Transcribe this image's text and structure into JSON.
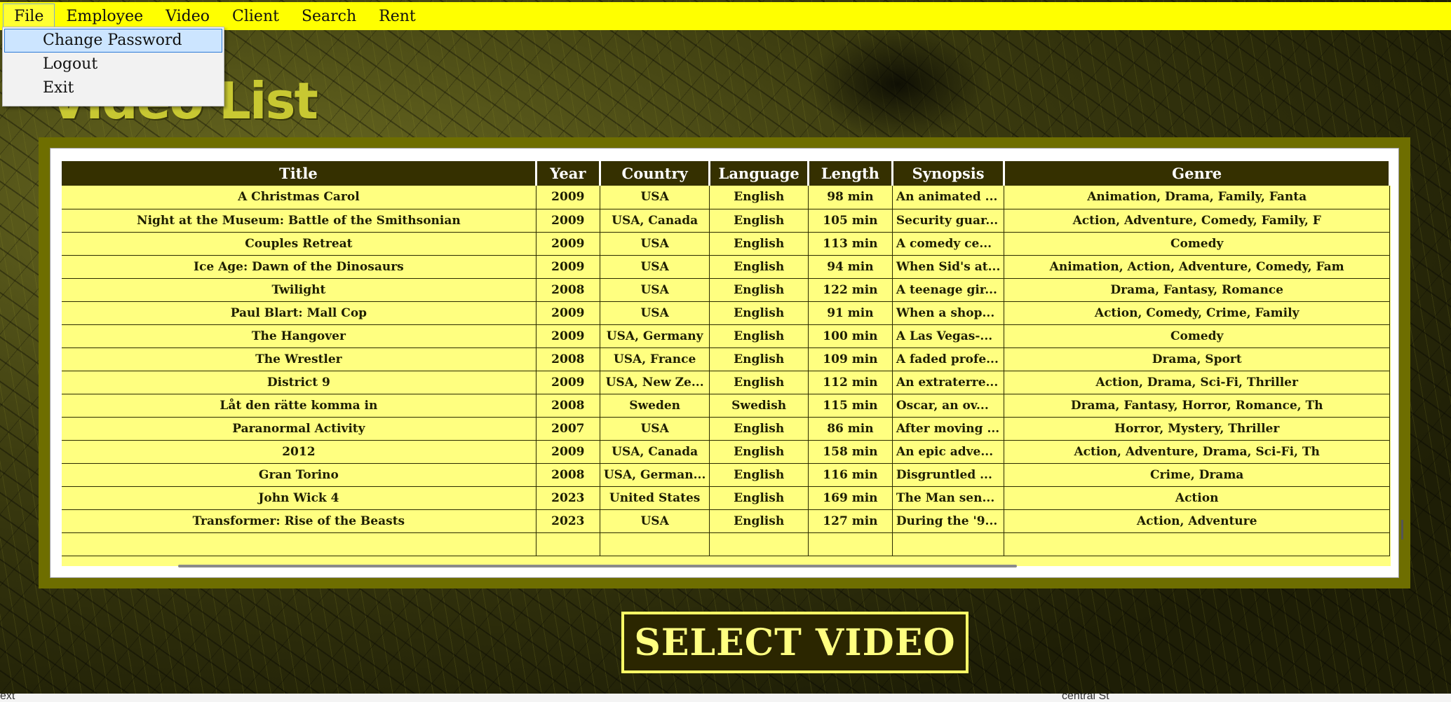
{
  "menu": {
    "items": [
      "File",
      "Employee",
      "Video",
      "Client",
      "Search",
      "Rent"
    ],
    "active": "File"
  },
  "file_menu": {
    "items": [
      "Change Password",
      "Logout",
      "Exit"
    ],
    "highlighted": "Change Password"
  },
  "page_title": "Video List",
  "table": {
    "columns": [
      "Title",
      "Year",
      "Country",
      "Language",
      "Length",
      "Synopsis",
      "Genre"
    ],
    "rows": [
      [
        "A Christmas Carol",
        "2009",
        "USA",
        "English",
        "98 min",
        "An animated ...",
        "Animation, Drama, Family, Fanta"
      ],
      [
        "Night at the Museum: Battle of the Smithsonian",
        "2009",
        "USA, Canada",
        "English",
        "105 min",
        "Security guar...",
        "Action, Adventure, Comedy, Family, F"
      ],
      [
        "Couples Retreat",
        "2009",
        "USA",
        "English",
        "113 min",
        "A comedy ce...",
        "Comedy"
      ],
      [
        "Ice Age: Dawn of the Dinosaurs",
        "2009",
        "USA",
        "English",
        "94 min",
        "When Sid's at...",
        "Animation, Action, Adventure, Comedy, Fam"
      ],
      [
        "Twilight",
        "2008",
        "USA",
        "English",
        "122 min",
        "A teenage gir...",
        "Drama, Fantasy, Romance"
      ],
      [
        "Paul Blart: Mall Cop",
        "2009",
        "USA",
        "English",
        "91 min",
        "When a shop...",
        "Action, Comedy, Crime, Family"
      ],
      [
        "The Hangover",
        "2009",
        "USA, Germany",
        "English",
        "100 min",
        "A Las Vegas-...",
        "Comedy"
      ],
      [
        "The Wrestler",
        "2008",
        "USA, France",
        "English",
        "109 min",
        "A faded profe...",
        "Drama, Sport"
      ],
      [
        "District 9",
        "2009",
        "USA, New Ze...",
        "English",
        "112 min",
        "An extraterre...",
        "Action, Drama, Sci-Fi, Thriller"
      ],
      [
        "Låt den rätte komma in",
        "2008",
        "Sweden",
        "Swedish",
        "115 min",
        "Oscar, an ov...",
        "Drama, Fantasy, Horror, Romance, Th"
      ],
      [
        "Paranormal Activity",
        "2007",
        "USA",
        "English",
        "86 min",
        "After moving ...",
        "Horror, Mystery, Thriller"
      ],
      [
        "2012",
        "2009",
        "USA, Canada",
        "English",
        "158 min",
        "An epic adve...",
        "Action, Adventure, Drama, Sci-Fi, Th"
      ],
      [
        "Gran Torino",
        "2008",
        "USA, German...",
        "English",
        "116 min",
        "Disgruntled ...",
        "Crime, Drama"
      ],
      [
        "John Wick 4",
        "2023",
        "United States",
        "English",
        "169 min",
        "The Man sen...",
        "Action"
      ],
      [
        "Transformer: Rise of the Beasts",
        "2023",
        "USA",
        "English",
        "127 min",
        "During the '9...",
        "Action, Adventure"
      ],
      [
        "",
        "",
        "",
        "",
        "",
        "",
        ""
      ]
    ]
  },
  "select_button_label": "SELECT VIDEO",
  "background_strip": {
    "left_text": "ext",
    "right_text": "central St"
  },
  "colors": {
    "menu_bar": "#ffff00",
    "table_frame": "#6e6e00",
    "table_header": "#353000",
    "table_body": "#ffff80",
    "title_text": "#c8c832",
    "button_bg": "#2b2600",
    "button_text": "#ffff80"
  }
}
